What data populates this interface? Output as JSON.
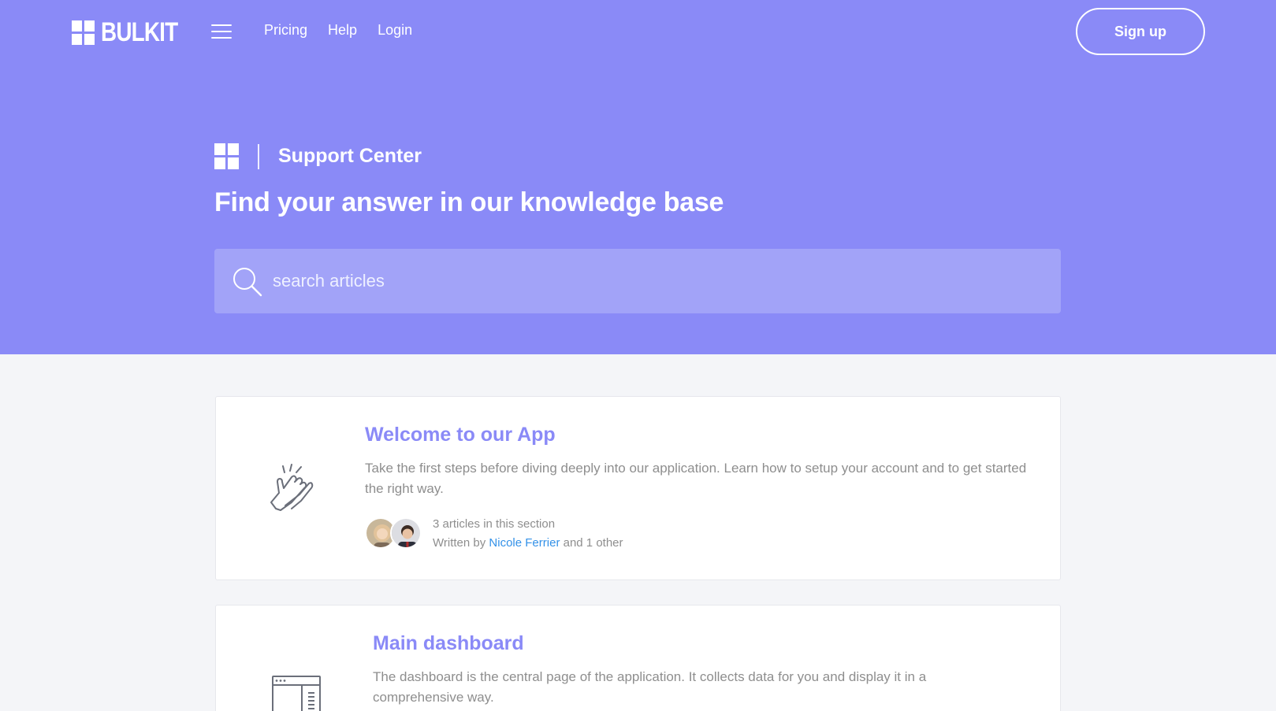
{
  "nav": {
    "brand": "BULKIT",
    "links": [
      "Pricing",
      "Help",
      "Login"
    ],
    "signup_label": "Sign up"
  },
  "hero": {
    "support_title": "Support Center",
    "headline": "Find your answer in our knowledge base",
    "search_placeholder": "search articles"
  },
  "sections": [
    {
      "title": "Welcome to our App",
      "description": "Take the first steps before diving deeply into our application. Learn how to setup your account and to get started the right way.",
      "article_count": "3 articles in this section",
      "written_by_prefix": "Written by",
      "author": "Nicole Ferrier",
      "written_by_suffix": "and 1 other",
      "icon": "clapping-hands-icon"
    },
    {
      "title": "Main dashboard",
      "description": "The dashboard is the central page of the application. It collects data for you and display it in a comprehensive way.",
      "icon": "dashboard-window-icon"
    }
  ],
  "colors": {
    "hero_bg": "#8a8af7",
    "search_bg": "#a2a3f8",
    "accent": "#8a8af7",
    "link": "#3391e8",
    "page_bg": "#f4f5f8"
  }
}
